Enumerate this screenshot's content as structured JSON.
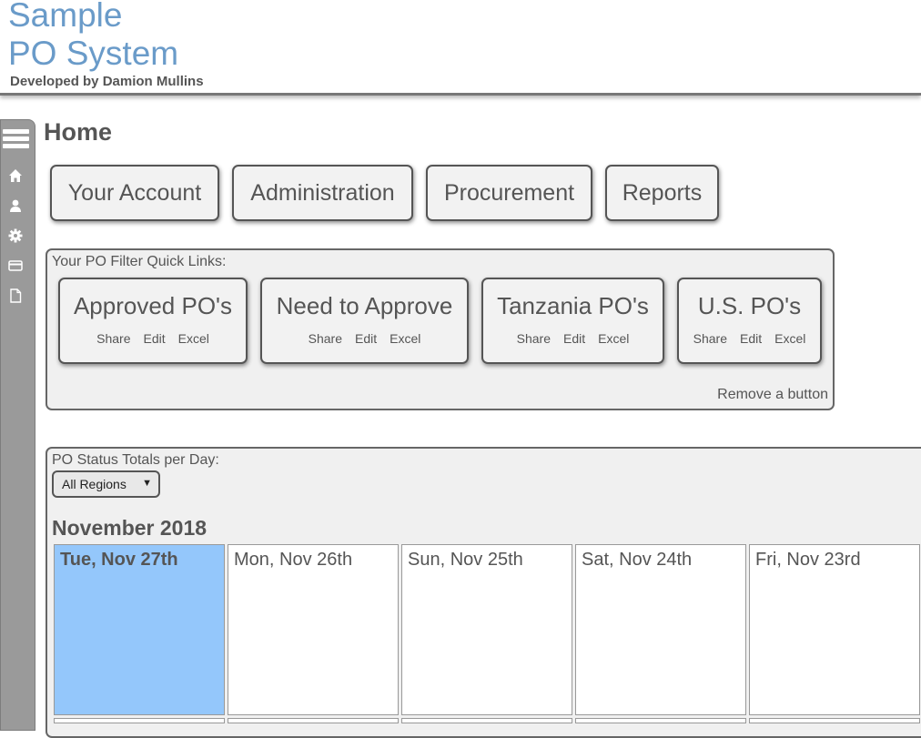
{
  "header": {
    "title_line1": "Sample",
    "title_line2": "PO System",
    "credit": "Developed by Damion Mullins"
  },
  "sidebar": {
    "icons": [
      "menu-icon",
      "home-icon",
      "user-icon",
      "gear-icon",
      "credit-card-icon",
      "document-icon"
    ]
  },
  "page": {
    "title": "Home"
  },
  "nav": {
    "your_account": "Your Account",
    "administration": "Administration",
    "procurement": "Procurement",
    "reports": "Reports"
  },
  "quick_links": {
    "label": "Your PO Filter Quick Links:",
    "items": [
      {
        "title": "Approved PO's",
        "share": "Share",
        "edit": "Edit",
        "excel": "Excel"
      },
      {
        "title": "Need to Approve",
        "share": "Share",
        "edit": "Edit",
        "excel": "Excel"
      },
      {
        "title": "Tanzania PO's",
        "share": "Share",
        "edit": "Edit",
        "excel": "Excel"
      },
      {
        "title": "U.S. PO's",
        "share": "Share",
        "edit": "Edit",
        "excel": "Excel"
      }
    ],
    "remove": "Remove a button"
  },
  "status": {
    "label": "PO Status Totals per Day:",
    "region_selected": "All Regions",
    "month": "November 2018",
    "days": [
      {
        "label": "Tue, Nov 27th",
        "today": true
      },
      {
        "label": "Mon, Nov 26th",
        "today": false
      },
      {
        "label": "Sun, Nov 25th",
        "today": false
      },
      {
        "label": "Sat, Nov 24th",
        "today": false
      },
      {
        "label": "Fri, Nov 23rd",
        "today": false
      }
    ]
  },
  "colors": {
    "title_blue": "#6a9bc9",
    "today_highlight": "#94c7fb",
    "sidebar_gray": "#9a9a9a"
  }
}
